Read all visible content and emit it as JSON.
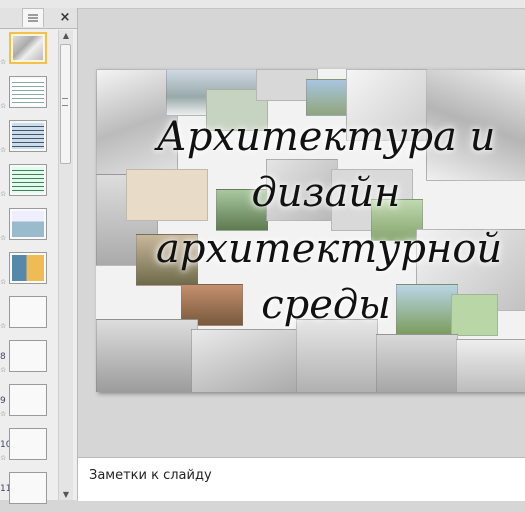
{
  "pane": {
    "tabs": {
      "slides_label": "",
      "outline_icon": "outline-icon",
      "close_label": "×"
    },
    "slides": [
      {
        "num": "",
        "selected": true
      },
      {
        "num": "",
        "selected": false
      },
      {
        "num": "",
        "selected": false
      },
      {
        "num": "",
        "selected": false
      },
      {
        "num": "",
        "selected": false
      },
      {
        "num": "",
        "selected": false
      },
      {
        "num": "",
        "selected": false
      },
      {
        "num": "8",
        "selected": false
      },
      {
        "num": "9",
        "selected": false
      },
      {
        "num": "10",
        "selected": false
      },
      {
        "num": "11",
        "selected": false
      }
    ]
  },
  "slide": {
    "title_lines": [
      "Архитектура и",
      "дизайн",
      "архитектурной",
      "среды"
    ]
  },
  "notes": {
    "placeholder": "Заметки к слайду"
  },
  "colors": {
    "selected_border": "#f0c050",
    "background": "#d6d6d6"
  }
}
